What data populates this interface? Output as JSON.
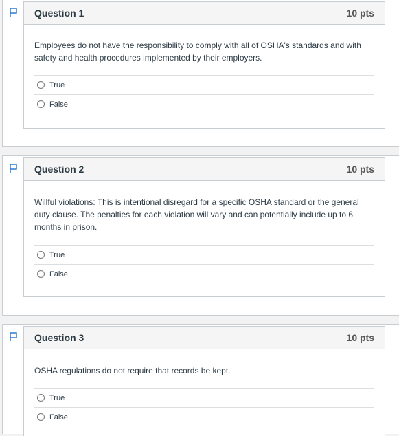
{
  "questions": [
    {
      "title": "Question 1",
      "points": "10 pts",
      "text": "Employees do not have the responsibility to comply with all of OSHA's standards and with safety and health procedures implemented by their employers.",
      "answers": [
        "True",
        "False"
      ]
    },
    {
      "title": "Question 2",
      "points": "10 pts",
      "text": "Willful violations: This is intentional disregard for a specific OSHA standard or the general duty clause. The penalties for each violation will vary and can potentially include up to 6 months in prison.",
      "answers": [
        "True",
        "False"
      ]
    },
    {
      "title": "Question 3",
      "points": "10 pts",
      "text": "OSHA regulations do not require that records be kept.",
      "answers": [
        "True",
        "False"
      ]
    }
  ],
  "colors": {
    "flag": "#2d7bd1",
    "border": "#c7cdd1",
    "header_bg": "#f5f5f5"
  },
  "icons": {
    "flag": "flag-outline-icon",
    "radio": "radio-button-icon"
  }
}
